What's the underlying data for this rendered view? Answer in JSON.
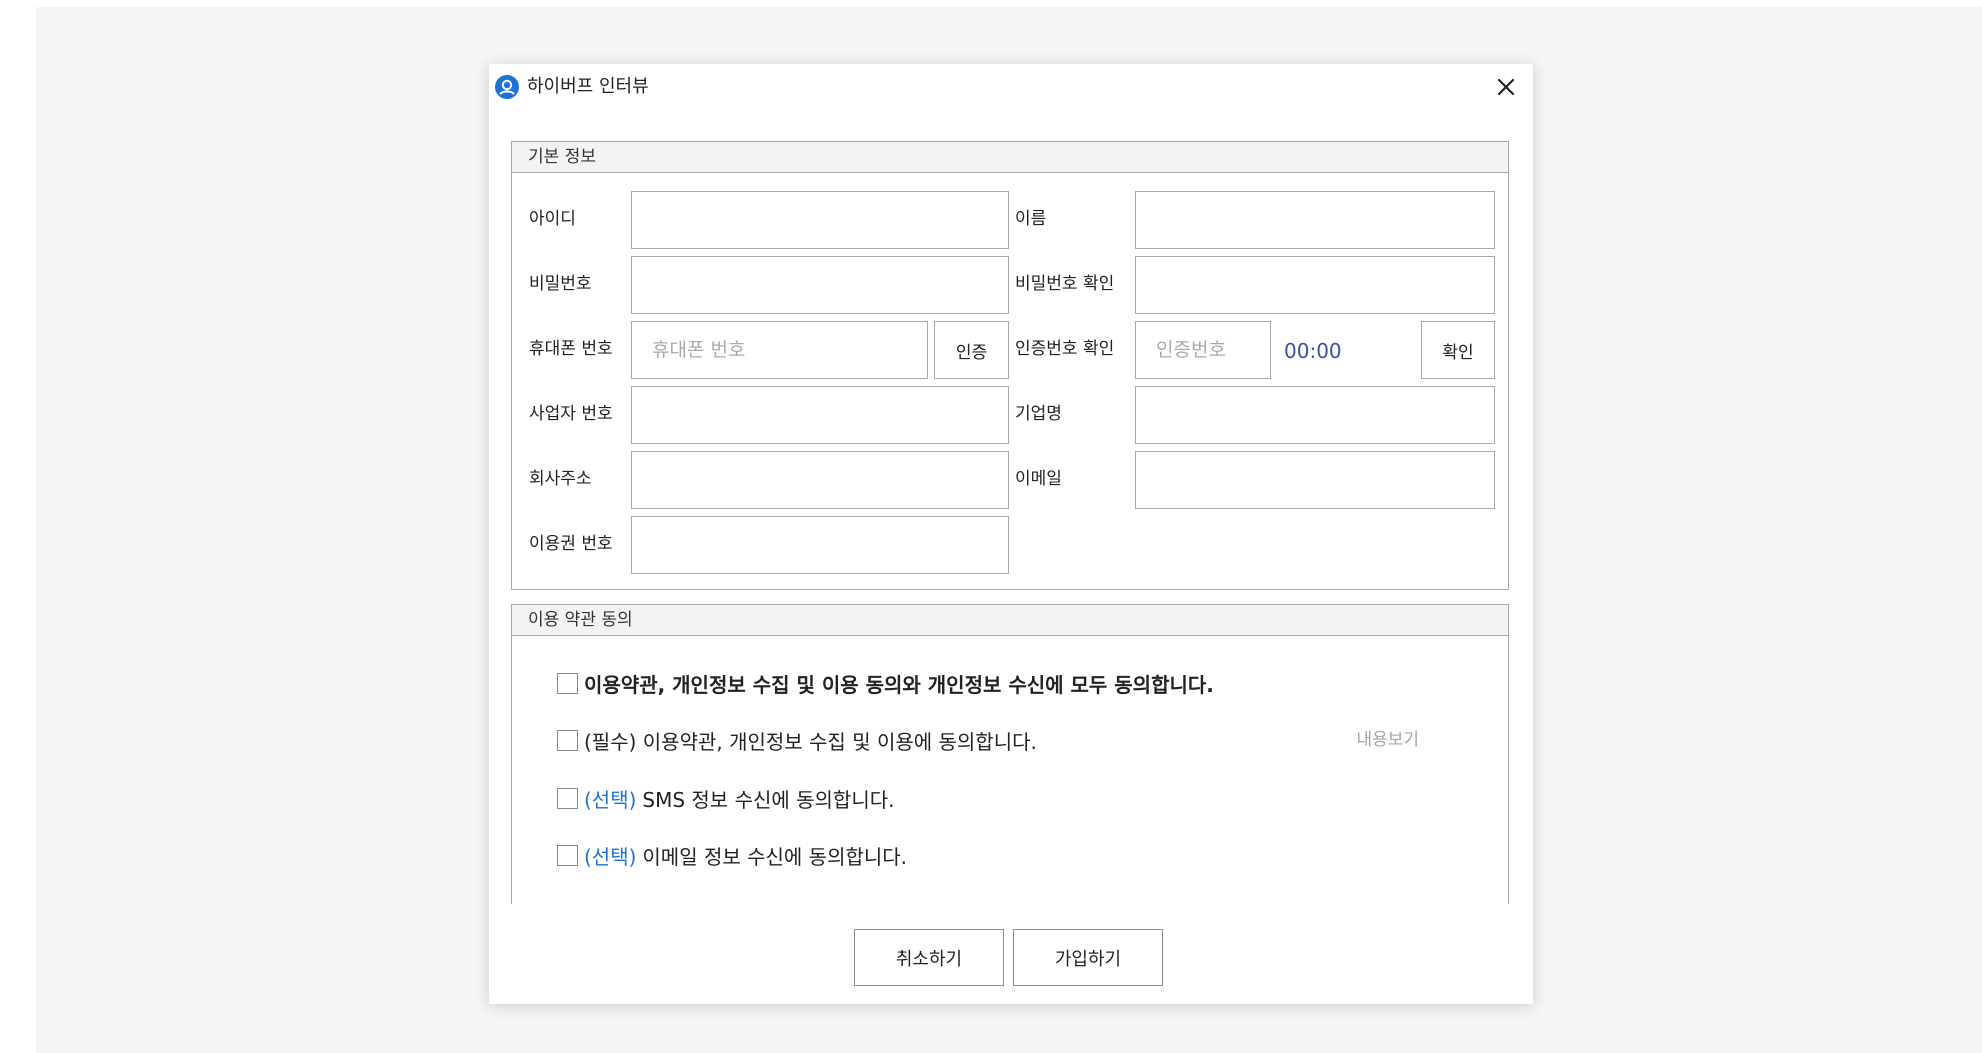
{
  "window": {
    "title": "하이버프 인터뷰",
    "app_icon": "user-circle-icon",
    "close_icon": "close-icon",
    "accent_color": "#1e72d6"
  },
  "basic_info": {
    "header": "기본 정보",
    "id_label": "아이디",
    "id_value": "",
    "name_label": "이름",
    "name_value": "",
    "password_label": "비밀번호",
    "password_value": "",
    "password_confirm_label": "비밀번호 확인",
    "password_confirm_value": "",
    "phone_label": "휴대폰 번호",
    "phone_placeholder": "휴대폰 번호",
    "phone_value": "",
    "verify_button": "인증",
    "code_label": "인증번호 확인",
    "code_placeholder": "인증번호",
    "code_value": "",
    "timer": "00:00",
    "timer_color": "#3b4fa8",
    "confirm_button": "확인",
    "business_number_label": "사업자 번호",
    "business_number_value": "",
    "company_name_label": "기업명",
    "company_name_value": "",
    "company_address_label": "회사주소",
    "company_address_value": "",
    "email_label": "이메일",
    "email_value": "",
    "voucher_number_label": "이용권 번호",
    "voucher_number_value": ""
  },
  "terms": {
    "header": "이용 약관 동의",
    "agree_all": "이용약관, 개인정보 수집 및 이용 동의와 개인정보 수신에 모두 동의합니다.",
    "required_terms": "(필수) 이용약관, 개인정보 수집 및 이용에 동의합니다.",
    "view_content": "내용보기",
    "optional_tag": "(선택)",
    "sms_text": "SMS 정보 수신에 동의합니다.",
    "email_text": "이메일 정보 수신에 동의합니다.",
    "agree_all_checked": false,
    "required_checked": false,
    "sms_checked": false,
    "email_checked": false
  },
  "footer": {
    "cancel": "취소하기",
    "signup": "가입하기"
  }
}
